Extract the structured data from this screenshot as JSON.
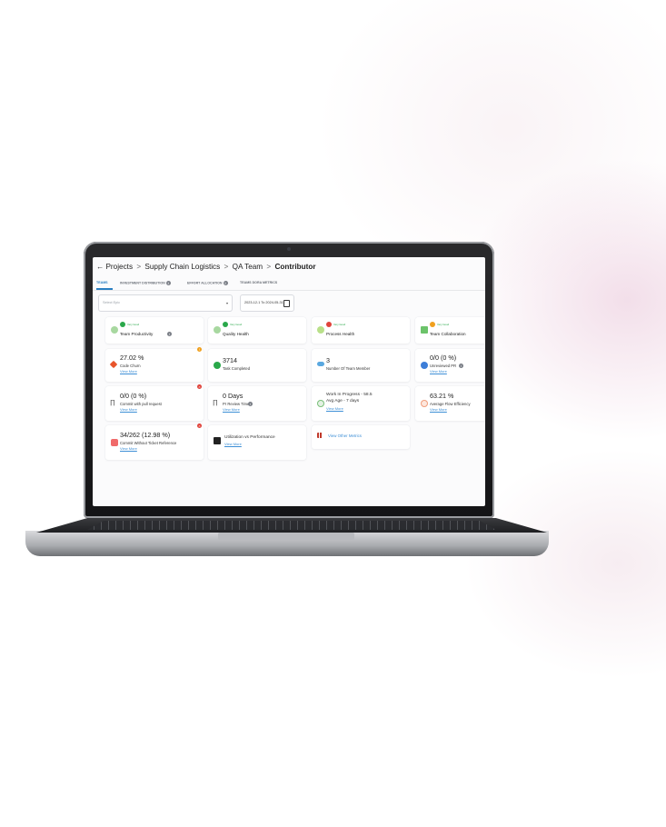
{
  "breadcrumb": {
    "back_icon": "arrow-left-icon",
    "projects": "Projects",
    "project": "Supply Chain Logistics",
    "team": "QA Team",
    "current": "Contributor",
    "separator": ">"
  },
  "tabs": [
    {
      "label": "TEAMS",
      "active": true
    },
    {
      "label": "INVESTMENT DISTRIBUTION",
      "info": true
    },
    {
      "label": "EFFORT ALLOCATION",
      "info": true
    },
    {
      "label": "TEAMS DORA METRICS"
    }
  ],
  "filters": {
    "select_placeholder": "Select Epic",
    "date_range": "2023-12-1 To 2024-05-31"
  },
  "health_cards": [
    {
      "status": "Very Good",
      "label": "Team Productivity",
      "color": "#2aa84a",
      "info": true
    },
    {
      "status": "Very Good",
      "label": "Quality Health",
      "color": "#2aa84a"
    },
    {
      "status": "Very Good",
      "label": "Process Health",
      "color": "#e0433b"
    },
    {
      "status": "Very Good",
      "label": "Team Collaboration",
      "color": "#f0a01e"
    }
  ],
  "metric_cards": [
    {
      "value": "27.02 %",
      "label": "Code Churn",
      "link": "View More",
      "icon": "diamond-icon"
    },
    {
      "value": "3714",
      "label": "Task Completed",
      "icon": "check-icon"
    },
    {
      "value": "3",
      "label": "Number Of Team Member",
      "icon": "people-icon"
    },
    {
      "value": "0/0 (0 %)",
      "label": "Unreviewed PR",
      "link": "View More",
      "icon": "pr-icon"
    },
    {
      "value": "0/0 (0 %)",
      "label": "Commit with pull request",
      "link": "View More",
      "icon": "branch-icon"
    },
    {
      "value": "0 Days",
      "label": "Pr Review Time",
      "link": "View More",
      "icon": "branch-icon"
    },
    {
      "value_line1": "Work In Progress - 58.5",
      "value_line2": "Avg Age - 7 days",
      "link": "View More",
      "icon": "progress-icon"
    },
    {
      "value": "63.21 %",
      "label": "Average Flow Efficiency",
      "link": "View More",
      "icon": "flow-icon"
    },
    {
      "value": "34/262 (12.98 %)",
      "label": "Commit Without Ticket Reference",
      "link": "View More",
      "icon": "ticket-icon"
    },
    {
      "label": "Utilization vs Performance",
      "link": "View More",
      "icon": "chart-icon"
    },
    {
      "label": "View Other Metrics",
      "icon": "grid-icon"
    }
  ],
  "colors": {
    "accent": "#2a7fc2",
    "link": "#3d8fd6",
    "good": "#2aa84a",
    "bad": "#e0433b",
    "warn": "#f0a01e"
  }
}
